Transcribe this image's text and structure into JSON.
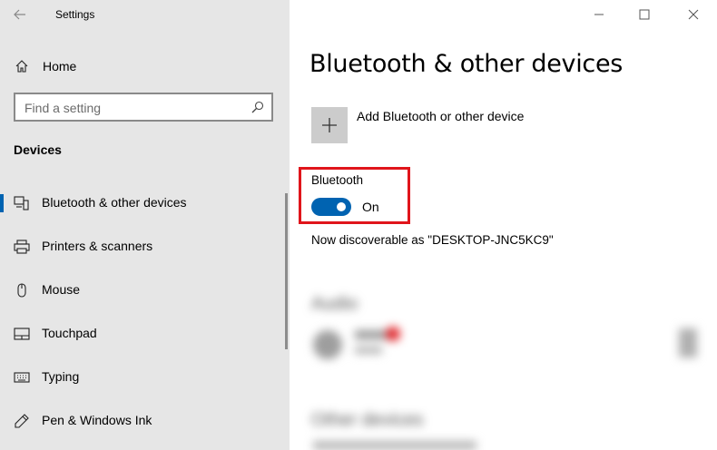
{
  "window": {
    "title": "Settings",
    "controls": [
      "minimize-icon",
      "maximize-icon",
      "close-icon"
    ]
  },
  "sidebar": {
    "home_label": "Home",
    "search_placeholder": "Find a setting",
    "section_title": "Devices",
    "items": [
      {
        "label": "Bluetooth & other devices",
        "icon": "bluetooth-devices-icon",
        "selected": true
      },
      {
        "label": "Printers & scanners",
        "icon": "printer-icon",
        "selected": false
      },
      {
        "label": "Mouse",
        "icon": "mouse-icon",
        "selected": false
      },
      {
        "label": "Touchpad",
        "icon": "touchpad-icon",
        "selected": false
      },
      {
        "label": "Typing",
        "icon": "keyboard-icon",
        "selected": false
      },
      {
        "label": "Pen & Windows Ink",
        "icon": "pen-icon",
        "selected": false
      }
    ]
  },
  "main": {
    "title": "Bluetooth & other devices",
    "add_device_label": "Add Bluetooth or other device",
    "bluetooth_label": "Bluetooth",
    "bluetooth_state": "On",
    "bluetooth_on": true,
    "discoverable_text": "Now discoverable as \"DESKTOP-JNC5KC9\""
  },
  "colors": {
    "accent": "#0063b1",
    "highlight_box": "#e0151b",
    "sidebar_bg": "#e6e6e6"
  }
}
